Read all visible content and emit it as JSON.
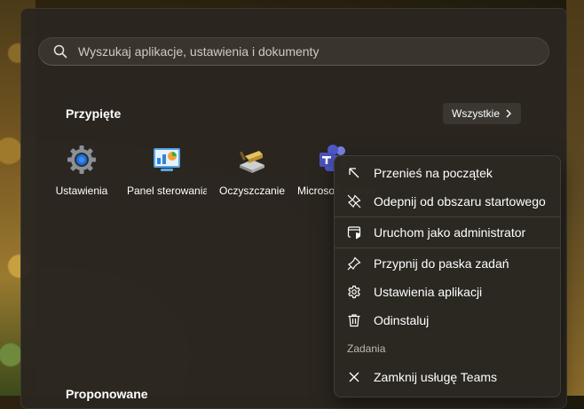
{
  "search": {
    "placeholder": "Wyszukaj aplikacje, ustawienia i dokumenty"
  },
  "pinned": {
    "title": "Przypięte",
    "all_button": "Wszystkie",
    "apps": [
      {
        "label": "Ustawienia",
        "icon": "settings-gear-icon"
      },
      {
        "label": "Panel sterowania",
        "icon": "control-panel-icon"
      },
      {
        "label": "Oczyszczanie",
        "icon": "disk-cleanup-icon"
      },
      {
        "label": "Microsoft Teams",
        "icon": "teams-icon"
      }
    ]
  },
  "recommended": {
    "title": "Proponowane"
  },
  "context_menu": {
    "items": [
      {
        "label": "Przenieś na początek",
        "icon": "arrow-up-left-icon"
      },
      {
        "label": "Odepnij od obszaru startowego",
        "icon": "unpin-icon"
      },
      {
        "label": "Uruchom jako administrator",
        "icon": "shield-window-icon"
      },
      {
        "label": "Przypnij do paska zadań",
        "icon": "pin-icon"
      },
      {
        "label": "Ustawienia aplikacji",
        "icon": "gear-icon"
      },
      {
        "label": "Odinstaluj",
        "icon": "trash-icon"
      }
    ],
    "tasks_heading": "Zadania",
    "tasks": [
      {
        "label": "Zamknij usługę Teams",
        "icon": "close-icon"
      }
    ]
  }
}
